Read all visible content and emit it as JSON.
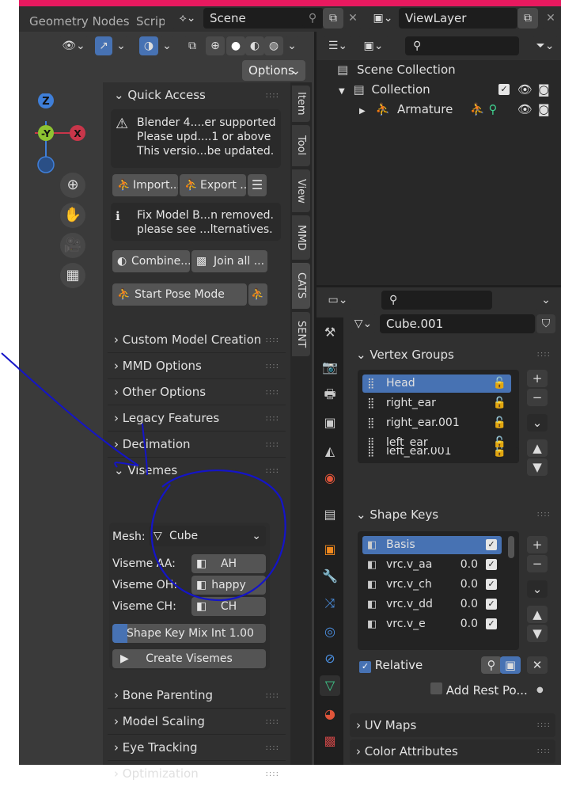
{
  "topbar": {
    "tabs": [
      "Geometry Nodes",
      "Script"
    ],
    "scene_name": "Scene",
    "view_layer_name": "ViewLayer"
  },
  "viewport": {
    "options_label": "Options",
    "gizmo_axes": {
      "z": "Z",
      "y": "-Y",
      "x": "X"
    }
  },
  "npanel": {
    "vertical_tabs": [
      "Item",
      "Tool",
      "View",
      "MMD",
      "CATS",
      "SENT"
    ],
    "quick_access": {
      "title": "Quick Access",
      "warning_lines": [
        "Blender 4....er supported",
        "Please upd....1 or above",
        "This versio...be updated."
      ],
      "import_label": "Import...",
      "export_label": "Export ...",
      "info_lines": [
        "Fix Model B...n removed.",
        "please see ...lternatives."
      ],
      "combine_label": "Combine...",
      "join_label": "Join all ...",
      "pose_label": "Start Pose Mode"
    },
    "sections": [
      "Custom Model Creation",
      "MMD Options",
      "Other Options",
      "Legacy Features",
      "Decimation"
    ],
    "visemes": {
      "title": "Visemes",
      "mesh_label": "Mesh:",
      "mesh_value": "Cube",
      "rows": [
        {
          "label": "Viseme AA:",
          "value": "AH"
        },
        {
          "label": "Viseme OH:",
          "value": "happy"
        },
        {
          "label": "Viseme CH:",
          "value": "CH"
        }
      ],
      "mix_label": "Shape Key Mix Int",
      "mix_value": "1.00",
      "mix_fraction": 0.1,
      "create_label": "Create Visemes"
    },
    "sections_after": [
      "Bone Parenting",
      "Model Scaling",
      "Eye Tracking",
      "Optimization"
    ]
  },
  "outliner": {
    "scene_collection": "Scene Collection",
    "collection": "Collection",
    "armature": "Armature"
  },
  "properties": {
    "object_name": "Cube.001",
    "vertex_groups": {
      "title": "Vertex Groups",
      "items": [
        "Head",
        "right_ear",
        "right_ear.001",
        "left_ear",
        "left_ear.001"
      ]
    },
    "shape_keys": {
      "title": "Shape Keys",
      "items": [
        {
          "name": "Basis",
          "value": ""
        },
        {
          "name": "vrc.v_aa",
          "value": "0.0"
        },
        {
          "name": "vrc.v_ch",
          "value": "0.0"
        },
        {
          "name": "vrc.v_dd",
          "value": "0.0"
        },
        {
          "name": "vrc.v_e",
          "value": "0.0"
        }
      ],
      "relative_label": "Relative",
      "add_rest_label": "Add Rest Po..."
    },
    "uv_maps": "UV Maps",
    "color_attributes": "Color Attributes"
  },
  "colors": {
    "accent_blue": "#4772b3",
    "brand_pink": "#e8195f",
    "annotation_stroke": "#1414c8"
  }
}
